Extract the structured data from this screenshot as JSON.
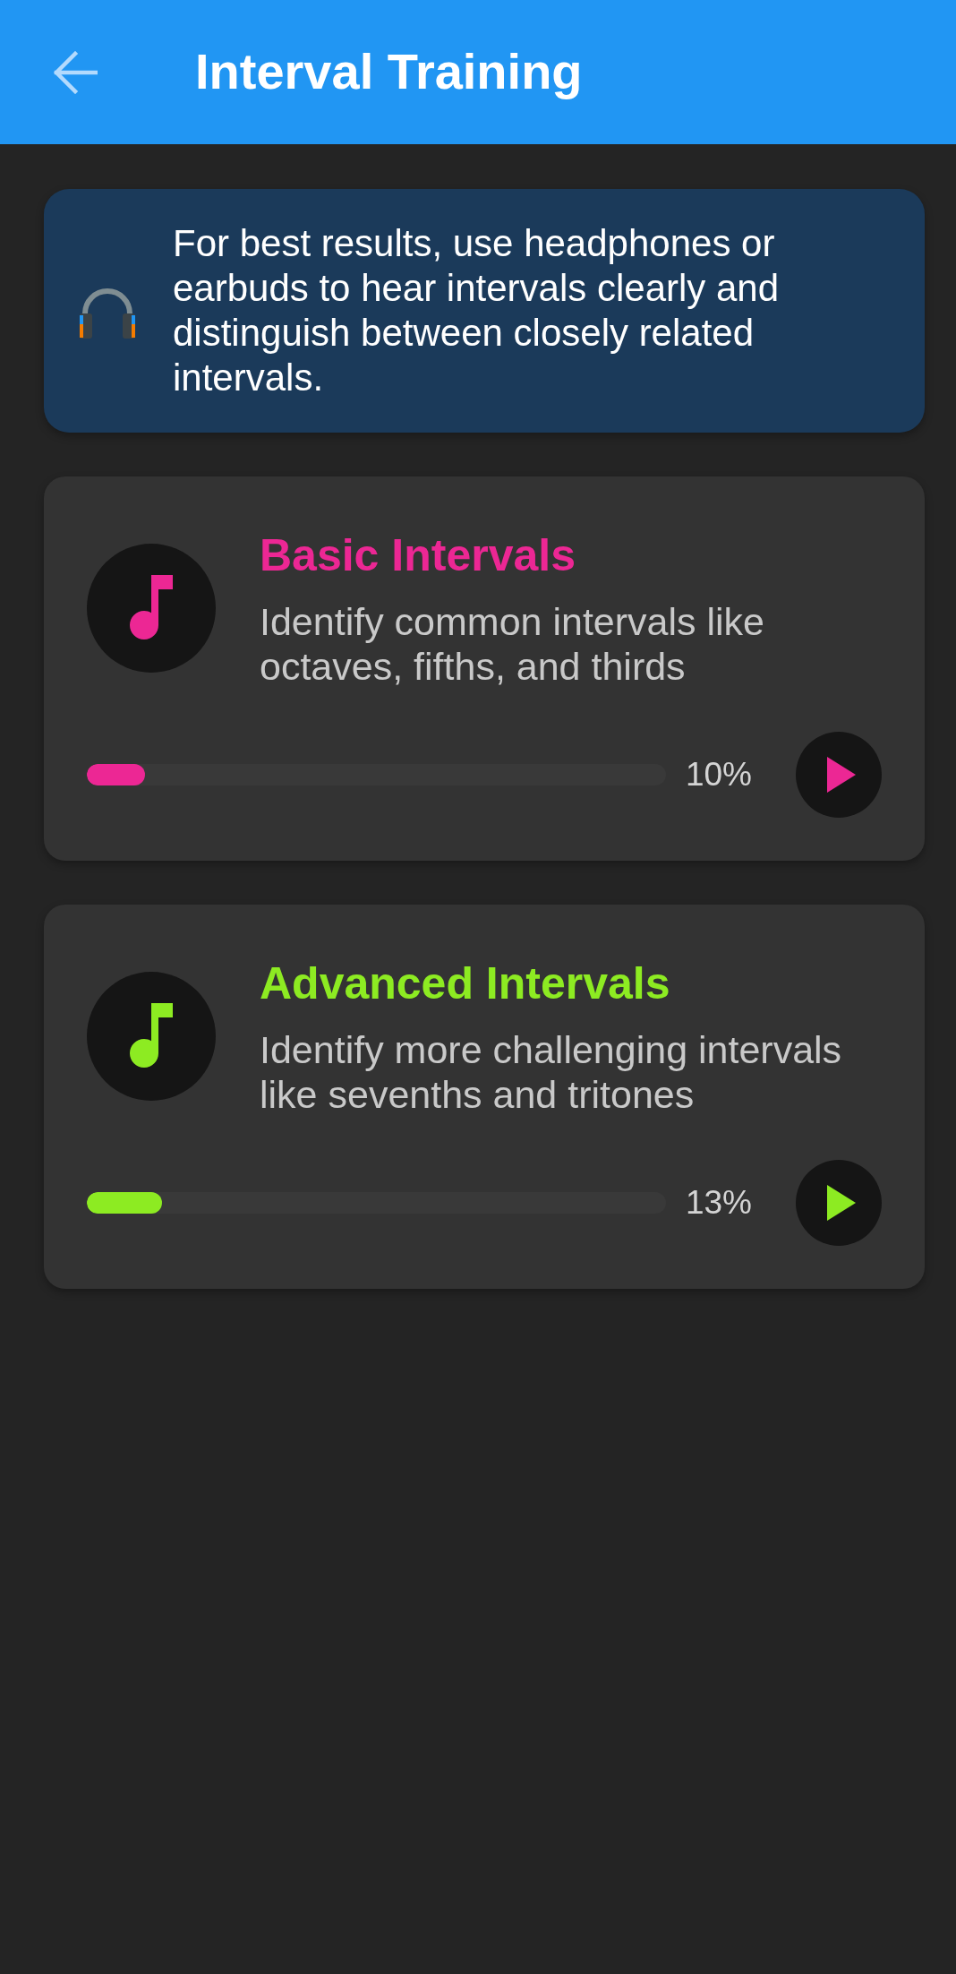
{
  "app_bar": {
    "title": "Interval Training"
  },
  "tip": {
    "text": "For best results, use headphones or earbuds to hear intervals clearly and distinguish between closely related intervals."
  },
  "exercises": [
    {
      "title": "Basic Intervals",
      "description": "Identify common intervals like octaves, fifths, and thirds",
      "level": 0.1,
      "percent": "10%",
      "color": "#ec2794"
    },
    {
      "title": "Advanced Intervals",
      "description": "Identify more challenging intervals like sevenths and tritones",
      "level": 0.13,
      "percent": "13%",
      "color": "#8deb22"
    }
  ]
}
